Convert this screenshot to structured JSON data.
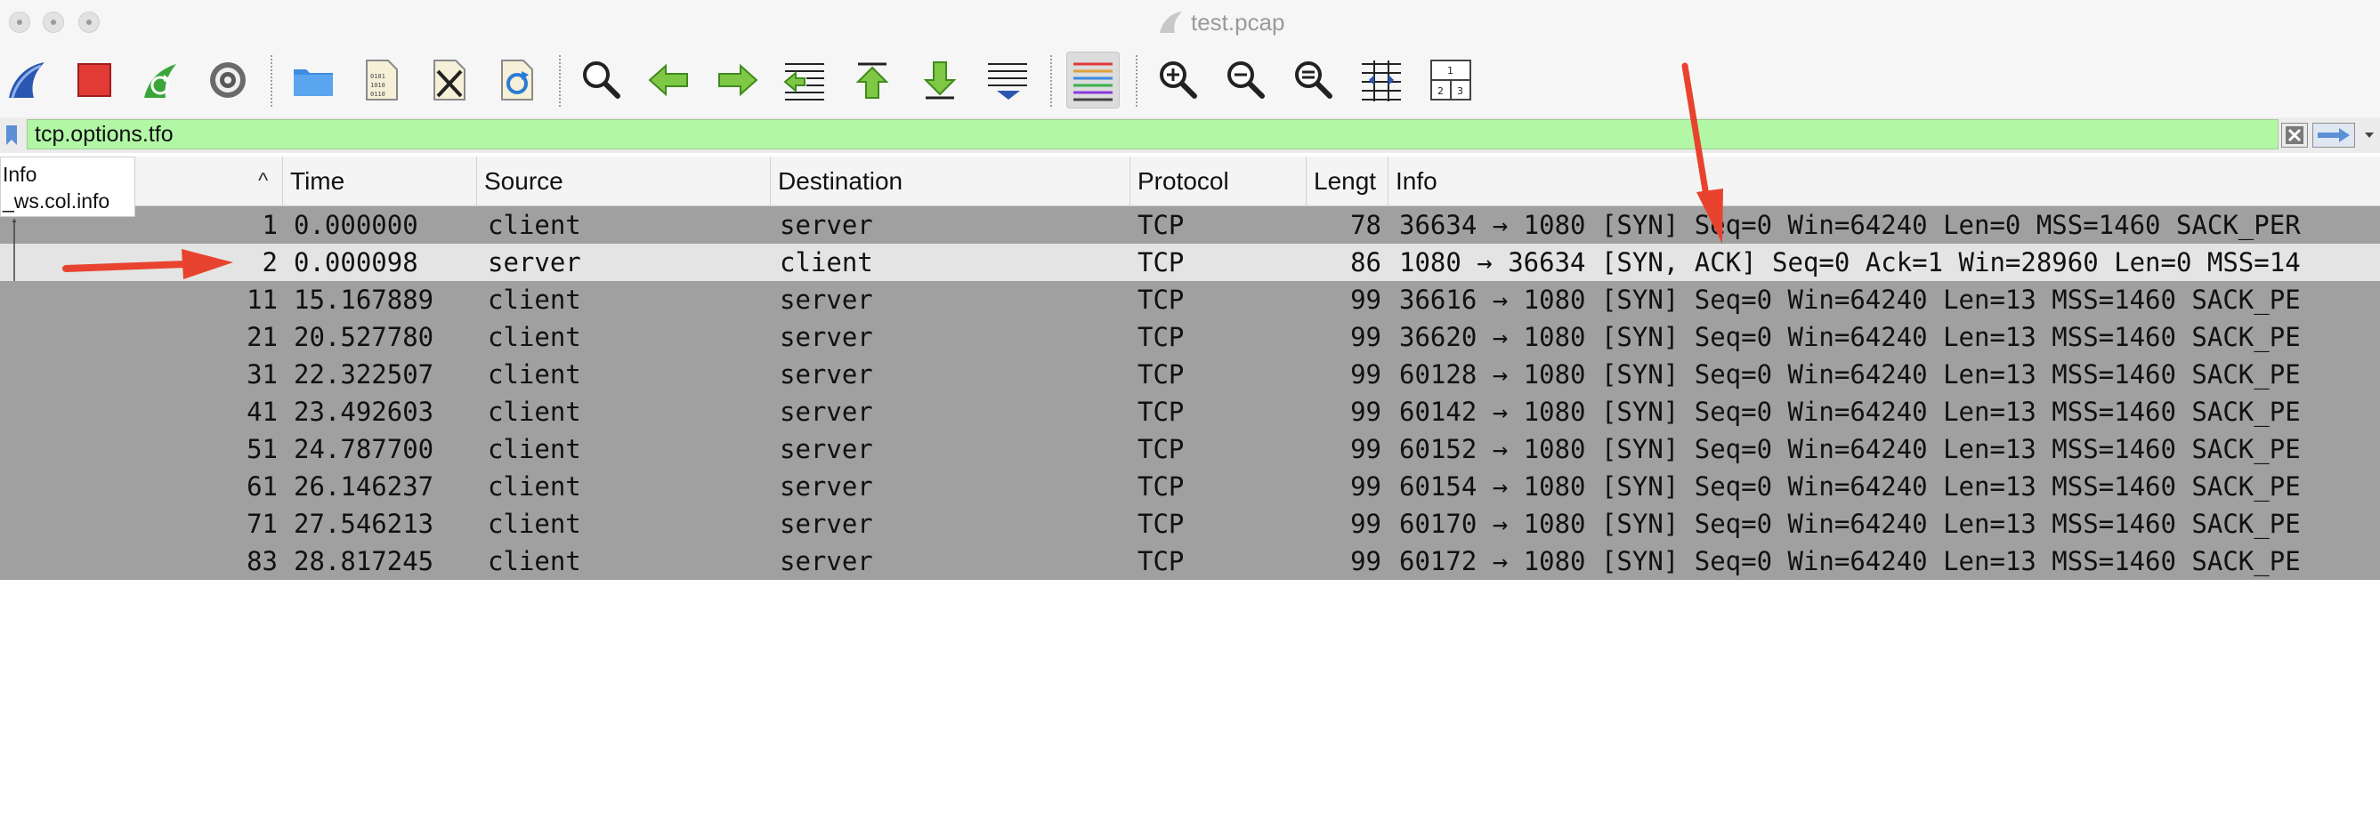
{
  "window": {
    "title": "test.pcap"
  },
  "toolbar": {
    "buttons": [
      {
        "name": "start-capture-button",
        "icon": "shark-fin-icon"
      },
      {
        "name": "stop-capture-button",
        "icon": "stop-icon"
      },
      {
        "name": "restart-capture-button",
        "icon": "restart-icon"
      },
      {
        "name": "capture-options-button",
        "icon": "gear-icon"
      },
      {
        "name": "open-file-button",
        "icon": "folder-icon"
      },
      {
        "name": "save-file-button",
        "icon": "file-binary-icon"
      },
      {
        "name": "close-file-button",
        "icon": "file-close-icon"
      },
      {
        "name": "reload-file-button",
        "icon": "file-reload-icon"
      },
      {
        "name": "find-packet-button",
        "icon": "magnifier-icon"
      },
      {
        "name": "go-back-button",
        "icon": "arrow-left-icon"
      },
      {
        "name": "go-forward-button",
        "icon": "arrow-right-icon"
      },
      {
        "name": "go-to-packet-button",
        "icon": "go-to-packet-icon"
      },
      {
        "name": "first-packet-button",
        "icon": "arrow-up-icon"
      },
      {
        "name": "last-packet-button",
        "icon": "arrow-down-icon"
      },
      {
        "name": "autoscroll-button",
        "icon": "autoscroll-icon"
      },
      {
        "name": "colorize-button",
        "icon": "colorize-icon",
        "active": true
      },
      {
        "name": "zoom-in-button",
        "icon": "zoom-in-icon"
      },
      {
        "name": "zoom-out-button",
        "icon": "zoom-out-icon"
      },
      {
        "name": "normal-size-button",
        "icon": "zoom-reset-icon"
      },
      {
        "name": "resize-columns-button",
        "icon": "resize-columns-icon"
      },
      {
        "name": "layout-button",
        "icon": "layout-icon"
      }
    ]
  },
  "filter": {
    "value": "tcp.options.tfo"
  },
  "tooltip": {
    "line1": "Info",
    "line2": "_ws.col.info"
  },
  "columns": {
    "no": "",
    "sort_glyph": "^",
    "time": "Time",
    "source": "Source",
    "destination": "Destination",
    "protocol": "Protocol",
    "length": "Lengt",
    "info": "Info"
  },
  "layout_icon_digits": [
    "1",
    "2",
    "3"
  ],
  "packets": [
    {
      "no": "1",
      "time": "0.000000",
      "source": "client",
      "destination": "server",
      "protocol": "TCP",
      "length": "78",
      "info": "36634 → 1080 [SYN] Seq=0 Win=64240 Len=0 MSS=1460 SACK_PER"
    },
    {
      "no": "2",
      "time": "0.000098",
      "source": "server",
      "destination": "client",
      "protocol": "TCP",
      "length": "86",
      "info": "1080 → 36634 [SYN, ACK] Seq=0 Ack=1 Win=28960 Len=0 MSS=14",
      "selected": true
    },
    {
      "no": "11",
      "time": "15.167889",
      "source": "client",
      "destination": "server",
      "protocol": "TCP",
      "length": "99",
      "info": "36616 → 1080 [SYN] Seq=0 Win=64240 Len=13 MSS=1460 SACK_PE"
    },
    {
      "no": "21",
      "time": "20.527780",
      "source": "client",
      "destination": "server",
      "protocol": "TCP",
      "length": "99",
      "info": "36620 → 1080 [SYN] Seq=0 Win=64240 Len=13 MSS=1460 SACK_PE"
    },
    {
      "no": "31",
      "time": "22.322507",
      "source": "client",
      "destination": "server",
      "protocol": "TCP",
      "length": "99",
      "info": "60128 → 1080 [SYN] Seq=0 Win=64240 Len=13 MSS=1460 SACK_PE"
    },
    {
      "no": "41",
      "time": "23.492603",
      "source": "client",
      "destination": "server",
      "protocol": "TCP",
      "length": "99",
      "info": "60142 → 1080 [SYN] Seq=0 Win=64240 Len=13 MSS=1460 SACK_PE"
    },
    {
      "no": "51",
      "time": "24.787700",
      "source": "client",
      "destination": "server",
      "protocol": "TCP",
      "length": "99",
      "info": "60152 → 1080 [SYN] Seq=0 Win=64240 Len=13 MSS=1460 SACK_PE"
    },
    {
      "no": "61",
      "time": "26.146237",
      "source": "client",
      "destination": "server",
      "protocol": "TCP",
      "length": "99",
      "info": "60154 → 1080 [SYN] Seq=0 Win=64240 Len=13 MSS=1460 SACK_PE"
    },
    {
      "no": "71",
      "time": "27.546213",
      "source": "client",
      "destination": "server",
      "protocol": "TCP",
      "length": "99",
      "info": "60170 → 1080 [SYN] Seq=0 Win=64240 Len=13 MSS=1460 SACK_PE"
    },
    {
      "no": "83",
      "time": "28.817245",
      "source": "client",
      "destination": "server",
      "protocol": "TCP",
      "length": "99",
      "info": "60172 → 1080 [SYN] Seq=0 Win=64240 Len=13 MSS=1460 SACK_PE"
    }
  ],
  "colors": {
    "row_bg": "#a0a0a0",
    "selected_row_bg": "#e4e4e4",
    "filter_bg": "#b2f7a6",
    "annotation_arrow": "#e8432f"
  }
}
